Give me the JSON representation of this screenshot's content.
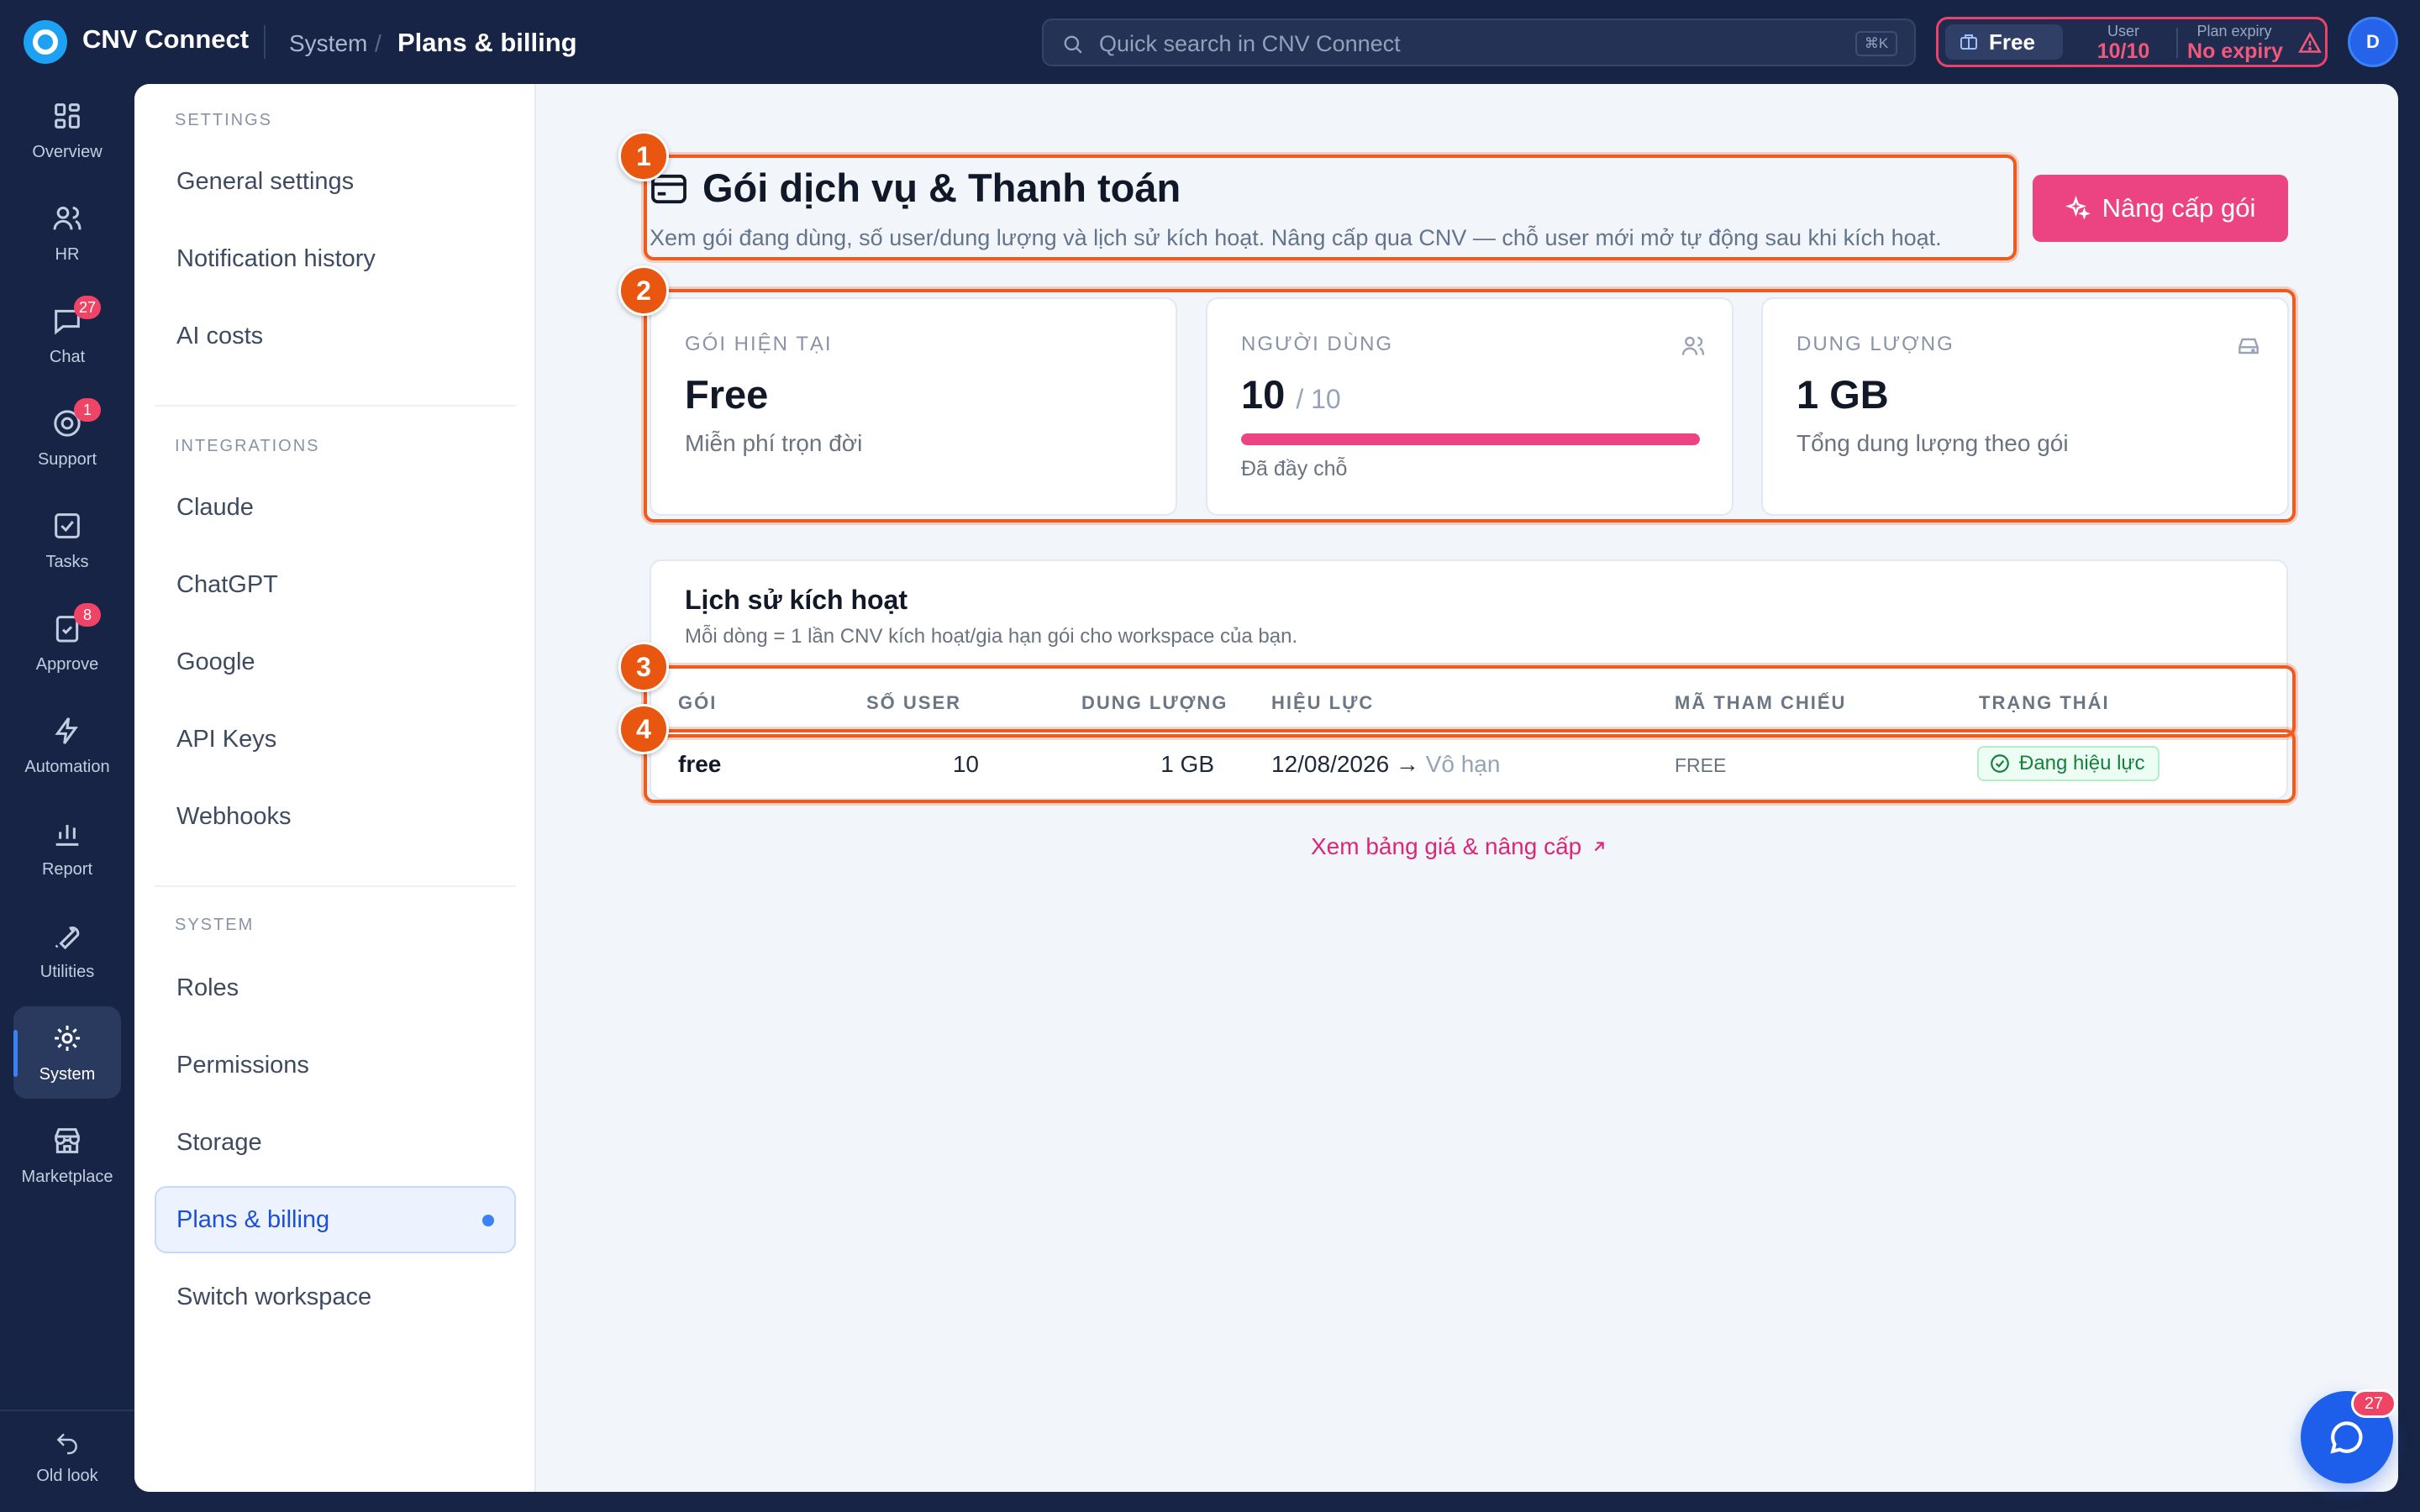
{
  "app": {
    "title": "CNV Connect"
  },
  "breadcrumb": {
    "section": "System",
    "page": "Plans & billing",
    "sep": "/"
  },
  "search": {
    "placeholder": "Quick search in CNV Connect",
    "shortcut": "⌘K"
  },
  "plan_pill": {
    "plan": "Free",
    "user_label": "User",
    "user_value": "10/10",
    "expiry_label": "Plan expiry",
    "expiry_value": "No expiry"
  },
  "avatar": {
    "initial": "D"
  },
  "rail": {
    "items": [
      {
        "label": "Overview",
        "icon": "grid-icon"
      },
      {
        "label": "HR",
        "icon": "users-icon"
      },
      {
        "label": "Chat",
        "icon": "chat-icon",
        "badge": "27"
      },
      {
        "label": "Support",
        "icon": "support-icon",
        "badge": "1"
      },
      {
        "label": "Tasks",
        "icon": "check-square-icon"
      },
      {
        "label": "Approve",
        "icon": "approve-icon",
        "badge": "8"
      },
      {
        "label": "Automation",
        "icon": "bolt-icon"
      },
      {
        "label": "Report",
        "icon": "bar-chart-icon"
      },
      {
        "label": "Utilities",
        "icon": "wrench-icon"
      },
      {
        "label": "System",
        "icon": "gear-icon",
        "active": true
      },
      {
        "label": "Marketplace",
        "icon": "store-icon"
      }
    ],
    "old_look": "Old look"
  },
  "subnav": {
    "settings_header": "SETTINGS",
    "settings": [
      "General settings",
      "Notification history",
      "AI costs"
    ],
    "integrations_header": "INTEGRATIONS",
    "integrations": [
      "Claude",
      "ChatGPT",
      "Google",
      "API Keys",
      "Webhooks"
    ],
    "system_header": "SYSTEM",
    "system": [
      "Roles",
      "Permissions",
      "Storage",
      "Plans & billing",
      "Switch workspace"
    ]
  },
  "annotations": [
    "1",
    "2",
    "3",
    "4"
  ],
  "page": {
    "title": "Gói dịch vụ & Thanh toán",
    "subtitle": "Xem gói đang dùng, số user/dung lượng và lịch sử kích hoạt. Nâng cấp qua CNV — chỗ user mới mở tự động sau khi kích hoạt.",
    "upgrade_button": "Nâng cấp gói"
  },
  "cards": {
    "plan": {
      "header": "GÓI HIỆN TẠI",
      "value": "Free",
      "sub": "Miễn phí trọn đời"
    },
    "users": {
      "header": "NGƯỜI DÙNG",
      "value": "10",
      "total": "/ 10",
      "progress": 1.0,
      "sub": "Đã đầy chỗ"
    },
    "storage": {
      "header": "DUNG LƯỢNG",
      "value": "1 GB",
      "sub": "Tổng dung lượng theo gói"
    }
  },
  "history": {
    "title": "Lịch sử kích hoạt",
    "subtitle": "Mỗi dòng = 1 lần CNV kích hoạt/gia hạn gói cho workspace của bạn.",
    "columns": [
      "GÓI",
      "SỐ USER",
      "DUNG LƯỢNG",
      "HIỆU LỰC",
      "MÃ THAM CHIẾU",
      "TRẠNG THÁI"
    ],
    "rows": [
      {
        "plan": "free",
        "users": "10",
        "storage": "1 GB",
        "valid_from": "12/08/2026",
        "arrow": "→",
        "valid_to": "Vô hạn",
        "ref": "FREE",
        "status": "Đang hiệu lực"
      }
    ]
  },
  "price_link": "Xem bảng giá & nâng cấp",
  "fab": {
    "badge": "27"
  },
  "colors": {
    "accent": "#ec4483",
    "annotation": "#e8560f",
    "nav_bg": "#172445",
    "primary": "#2563eb"
  }
}
